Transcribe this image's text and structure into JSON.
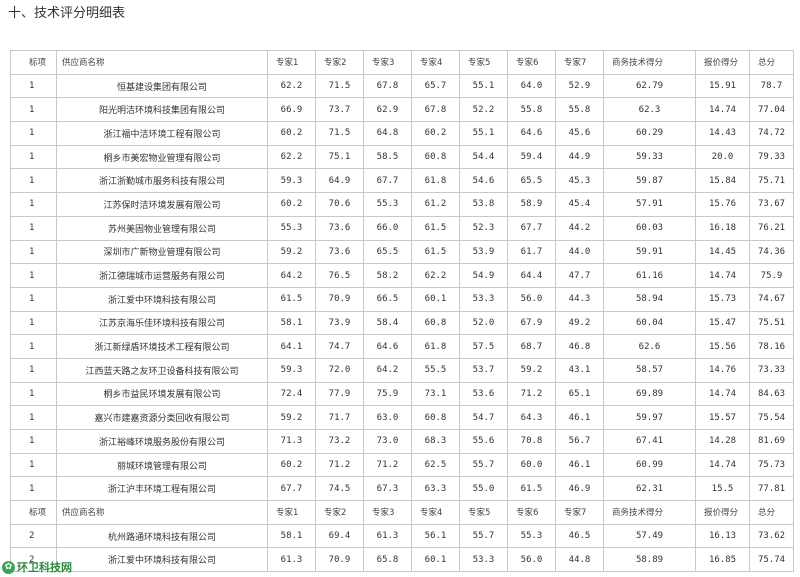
{
  "title": "十、技术评分明细表",
  "header": [
    "标项",
    "供应商名称",
    "专家1",
    "专家2",
    "专家3",
    "专家4",
    "专家5",
    "专家6",
    "专家7",
    "商务技术得分",
    "报价得分",
    "总分"
  ],
  "rows": [
    [
      "1",
      "恒基建设集团有限公司",
      "62.2",
      "71.5",
      "67.8",
      "65.7",
      "55.1",
      "64.0",
      "52.9",
      "62.79",
      "15.91",
      "78.7"
    ],
    [
      "1",
      "阳光明洁环境科技集团有限公司",
      "66.9",
      "73.7",
      "62.9",
      "67.8",
      "52.2",
      "55.8",
      "55.8",
      "62.3",
      "14.74",
      "77.04"
    ],
    [
      "1",
      "浙江福中洁环境工程有限公司",
      "60.2",
      "71.5",
      "64.8",
      "60.2",
      "55.1",
      "64.6",
      "45.6",
      "60.29",
      "14.43",
      "74.72"
    ],
    [
      "1",
      "桐乡市美宏物业管理有限公司",
      "62.2",
      "75.1",
      "58.5",
      "60.8",
      "54.4",
      "59.4",
      "44.9",
      "59.33",
      "20.0",
      "79.33"
    ],
    [
      "1",
      "浙江浙勤城市服务科技有限公司",
      "59.3",
      "64.9",
      "67.7",
      "61.8",
      "54.6",
      "65.5",
      "45.3",
      "59.87",
      "15.84",
      "75.71"
    ],
    [
      "1",
      "江苏保时洁环境发展有限公司",
      "60.2",
      "70.6",
      "55.3",
      "61.2",
      "53.8",
      "58.9",
      "45.4",
      "57.91",
      "15.76",
      "73.67"
    ],
    [
      "1",
      "苏州美固物业管理有限公司",
      "55.3",
      "73.6",
      "66.0",
      "61.5",
      "52.3",
      "67.7",
      "44.2",
      "60.03",
      "16.18",
      "76.21"
    ],
    [
      "1",
      "深圳市广新物业管理有限公司",
      "59.2",
      "73.6",
      "65.5",
      "61.5",
      "53.9",
      "61.7",
      "44.0",
      "59.91",
      "14.45",
      "74.36"
    ],
    [
      "1",
      "浙江德瑞城市运营服务有限公司",
      "64.2",
      "76.5",
      "58.2",
      "62.2",
      "54.9",
      "64.4",
      "47.7",
      "61.16",
      "14.74",
      "75.9"
    ],
    [
      "1",
      "浙江爱中环境科技有限公司",
      "61.5",
      "70.9",
      "66.5",
      "60.1",
      "53.3",
      "56.0",
      "44.3",
      "58.94",
      "15.73",
      "74.67"
    ],
    [
      "1",
      "江苏京海乐佳环境科技有限公司",
      "58.1",
      "73.9",
      "58.4",
      "60.8",
      "52.0",
      "67.9",
      "49.2",
      "60.04",
      "15.47",
      "75.51"
    ],
    [
      "1",
      "浙江新绿盾环境技术工程有限公司",
      "64.1",
      "74.7",
      "64.6",
      "61.8",
      "57.5",
      "68.7",
      "46.8",
      "62.6",
      "15.56",
      "78.16"
    ],
    [
      "1",
      "江西蓝天路之友环卫设备科技有限公司",
      "59.3",
      "72.0",
      "64.2",
      "55.5",
      "53.7",
      "59.2",
      "43.1",
      "58.57",
      "14.76",
      "73.33"
    ],
    [
      "1",
      "桐乡市益民环境发展有限公司",
      "72.4",
      "77.9",
      "75.9",
      "73.1",
      "53.6",
      "71.2",
      "65.1",
      "69.89",
      "14.74",
      "84.63"
    ],
    [
      "1",
      "嘉兴市建嘉资源分类回收有限公司",
      "59.2",
      "71.7",
      "63.0",
      "60.8",
      "54.7",
      "64.3",
      "46.1",
      "59.97",
      "15.57",
      "75.54"
    ],
    [
      "1",
      "浙江裕峰环境服务股份有限公司",
      "71.3",
      "73.2",
      "73.0",
      "68.3",
      "55.6",
      "70.8",
      "56.7",
      "67.41",
      "14.28",
      "81.69"
    ],
    [
      "1",
      "丽城环境管理有限公司",
      "60.2",
      "71.2",
      "71.2",
      "62.5",
      "55.7",
      "60.0",
      "46.1",
      "60.99",
      "14.74",
      "75.73"
    ],
    [
      "1",
      "浙江沪丰环境工程有限公司",
      "67.7",
      "74.5",
      "67.3",
      "63.3",
      "55.0",
      "61.5",
      "46.9",
      "62.31",
      "15.5",
      "77.81"
    ],
    [
      "标项",
      "供应商名称",
      "专家1",
      "专家2",
      "专家3",
      "专家4",
      "专家5",
      "专家6",
      "专家7",
      "商务技术得分",
      "报价得分",
      "总分"
    ],
    [
      "2",
      "杭州路通环境科技有限公司",
      "58.1",
      "69.4",
      "61.3",
      "56.1",
      "55.7",
      "55.3",
      "46.5",
      "57.49",
      "16.13",
      "73.62"
    ],
    [
      "2",
      "浙江爱中环境科技有限公司",
      "61.3",
      "70.9",
      "65.8",
      "60.1",
      "53.3",
      "56.0",
      "44.8",
      "58.89",
      "16.85",
      "75.74"
    ]
  ],
  "watermark": {
    "text": "环卫科技网",
    "icon": "leaf-logo-icon",
    "color": "#2b8a3e"
  }
}
